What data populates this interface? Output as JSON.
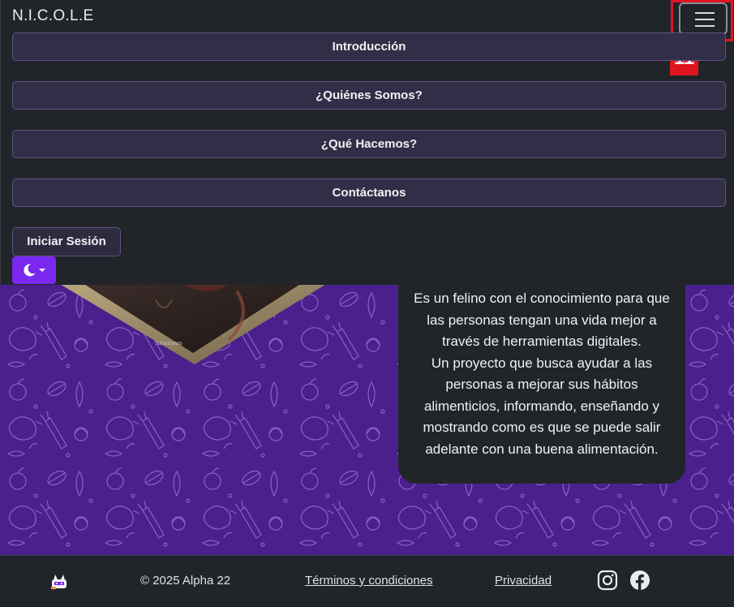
{
  "navbar": {
    "brand": "N.I.C.O.L.E",
    "toggler_icon": "hamburger-menu-icon",
    "annotation_label": "11",
    "menu": [
      {
        "label": "Introducción"
      },
      {
        "label": "¿Quiénes Somos?"
      },
      {
        "label": "¿Qué Hacemos?"
      },
      {
        "label": "Contáctanos"
      }
    ],
    "login_label": "Iniciar Sesión",
    "theme_icon": "moon-icon"
  },
  "hero": {
    "image_caption": "Amazonas",
    "about_line1": "Es un felino con el conocimiento para que las personas tengan una vida mejor a través de herramientas digitales.",
    "about_line2": "Un proyecto que busca ayudar a las personas a mejorar sus hábitos alimenticios, informando, enseñando y mostrando como es que se puede salir adelante con una buena alimentación."
  },
  "footer": {
    "copyright": "© 2025 Alpha 22",
    "terms_label": "Términos y condiciones",
    "privacy_label": "Privacidad",
    "icons": [
      "instagram-icon",
      "facebook-icon"
    ]
  },
  "colors": {
    "background": "#212529",
    "accent": "#7a28f0",
    "menu_button": "#332e47",
    "hero_purple": "#4b1f8c",
    "annotation": "#e01421"
  }
}
